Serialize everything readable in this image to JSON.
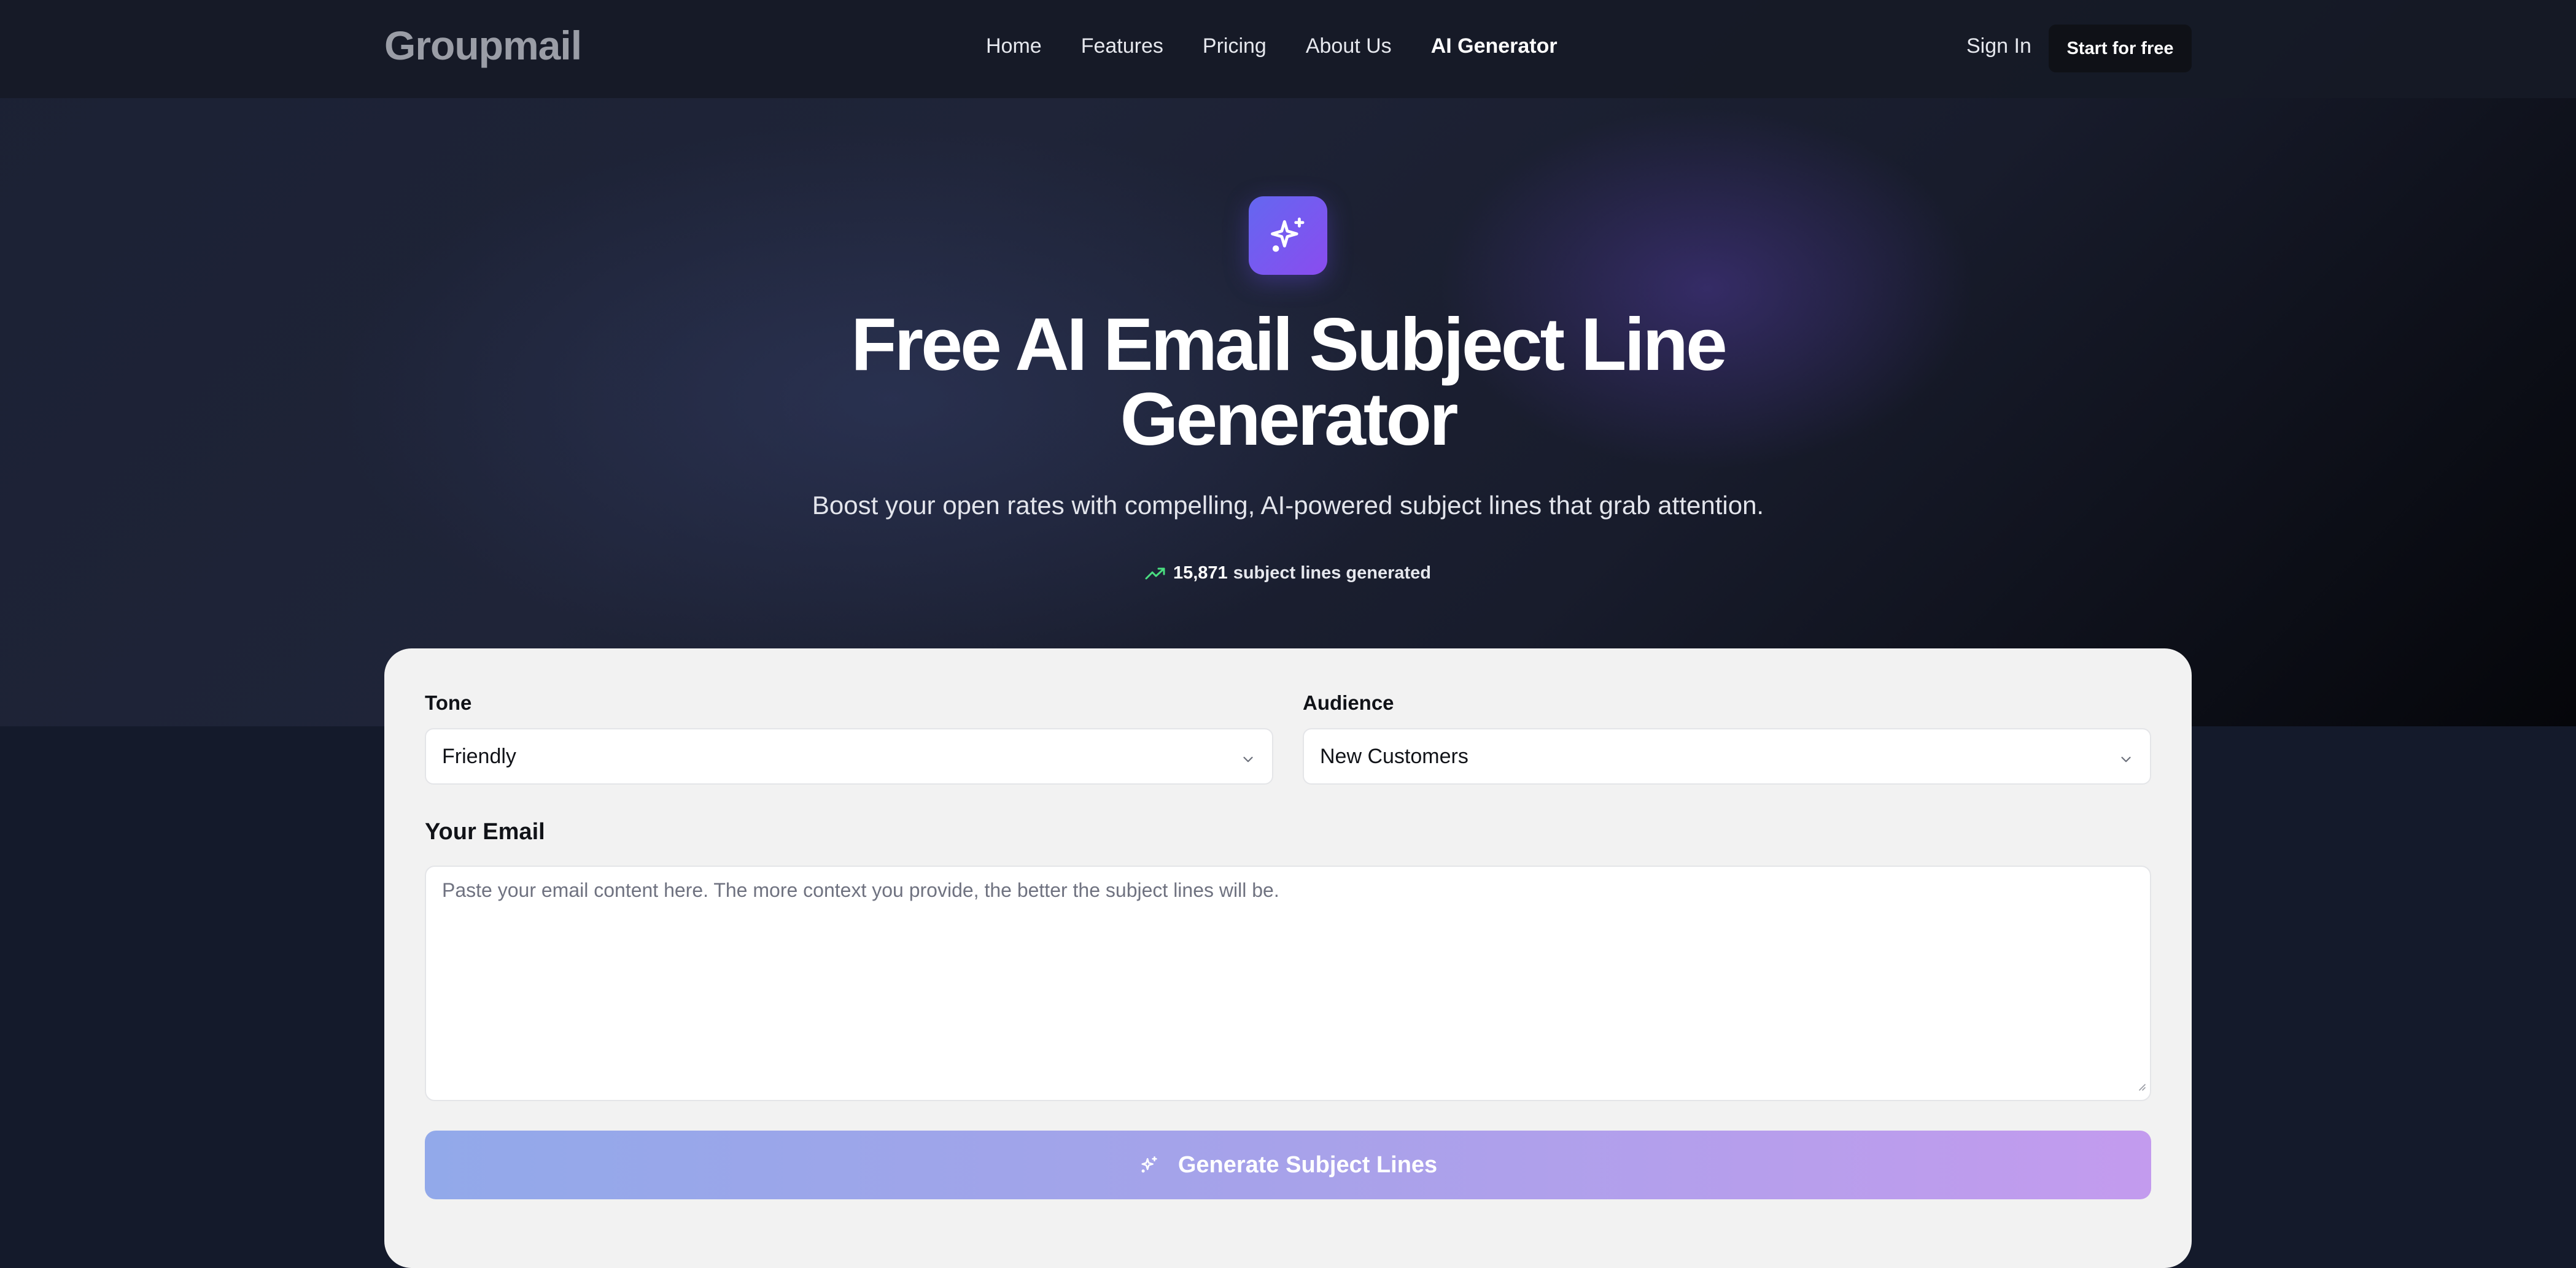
{
  "nav": {
    "logo": "Groupmail",
    "links": [
      {
        "label": "Home"
      },
      {
        "label": "Features"
      },
      {
        "label": "Pricing"
      },
      {
        "label": "About Us"
      },
      {
        "label": "AI Generator",
        "active": true
      }
    ],
    "sign_in": "Sign In",
    "cta": "Start for free"
  },
  "hero": {
    "icon": "sparkles-icon",
    "title": "Free AI Email Subject Line Generator",
    "subtitle": "Boost your open rates with compelling, AI-powered subject lines that grab attention.",
    "stat_count": "15,871",
    "stat_label": "subject lines generated",
    "stat_icon": "trending-up-icon"
  },
  "form": {
    "tone_label": "Tone",
    "tone_value": "Friendly",
    "audience_label": "Audience",
    "audience_value": "New Customers",
    "email_label": "Your Email",
    "email_placeholder": "Paste your email content here. The more context you provide, the better the subject lines will be.",
    "email_value": "",
    "generate_label": "Generate Subject Lines"
  },
  "colors": {
    "icon_gradient_start": "#6467f0",
    "icon_gradient_end": "#8a4cef",
    "button_gradient_start": "#92a9ea",
    "button_gradient_end": "#c39bee",
    "trend_green": "#4ade80"
  }
}
